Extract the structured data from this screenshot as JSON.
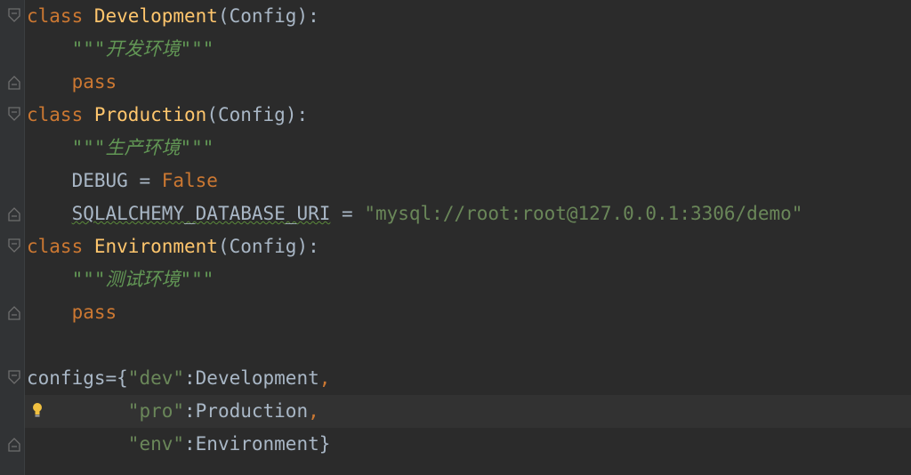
{
  "editor": {
    "language": "python",
    "colors": {
      "background": "#2b2b2b",
      "gutter": "#313335",
      "keyword": "#cc7832",
      "class_name": "#ffc66d",
      "default_text": "#a9b7c6",
      "docstring": "#629755",
      "string": "#6a8759",
      "caret_row": "#323232"
    },
    "lines": {
      "l1": {
        "kw": "class",
        "name": "Development",
        "rest": "(Config):"
      },
      "l2": {
        "doc": "\"\"\"开发环境\"\"\""
      },
      "l3": {
        "kw": "pass"
      },
      "l4": {
        "kw": "class",
        "name": "Production",
        "rest": "(Config):"
      },
      "l5": {
        "doc": "\"\"\"生产环境\"\"\""
      },
      "l6": {
        "var": "DEBUG",
        "op": " = ",
        "value": "False"
      },
      "l7": {
        "var": "SQLALCHEMY_DATABASE_URI",
        "op": " = ",
        "value": "\"mysql://root:root@127.0.0.1:3306/demo\""
      },
      "l8": {
        "kw": "class",
        "name": "Environment",
        "rest": "(Config):"
      },
      "l9": {
        "doc": "\"\"\"测试环境\"\"\""
      },
      "l10": {
        "kw": "pass"
      },
      "l12": {
        "prefix": "configs={",
        "key": "\"dev\"",
        "value": ":Development",
        "end": ","
      },
      "l13": {
        "key": "\"pro\"",
        "value": ":Production",
        "end": ","
      },
      "l14": {
        "key": "\"env\"",
        "value": ":Environment}"
      }
    },
    "icons": {
      "fold_open": "fold-open-icon",
      "fold_close": "fold-close-icon",
      "intention": "lightbulb-icon"
    }
  }
}
